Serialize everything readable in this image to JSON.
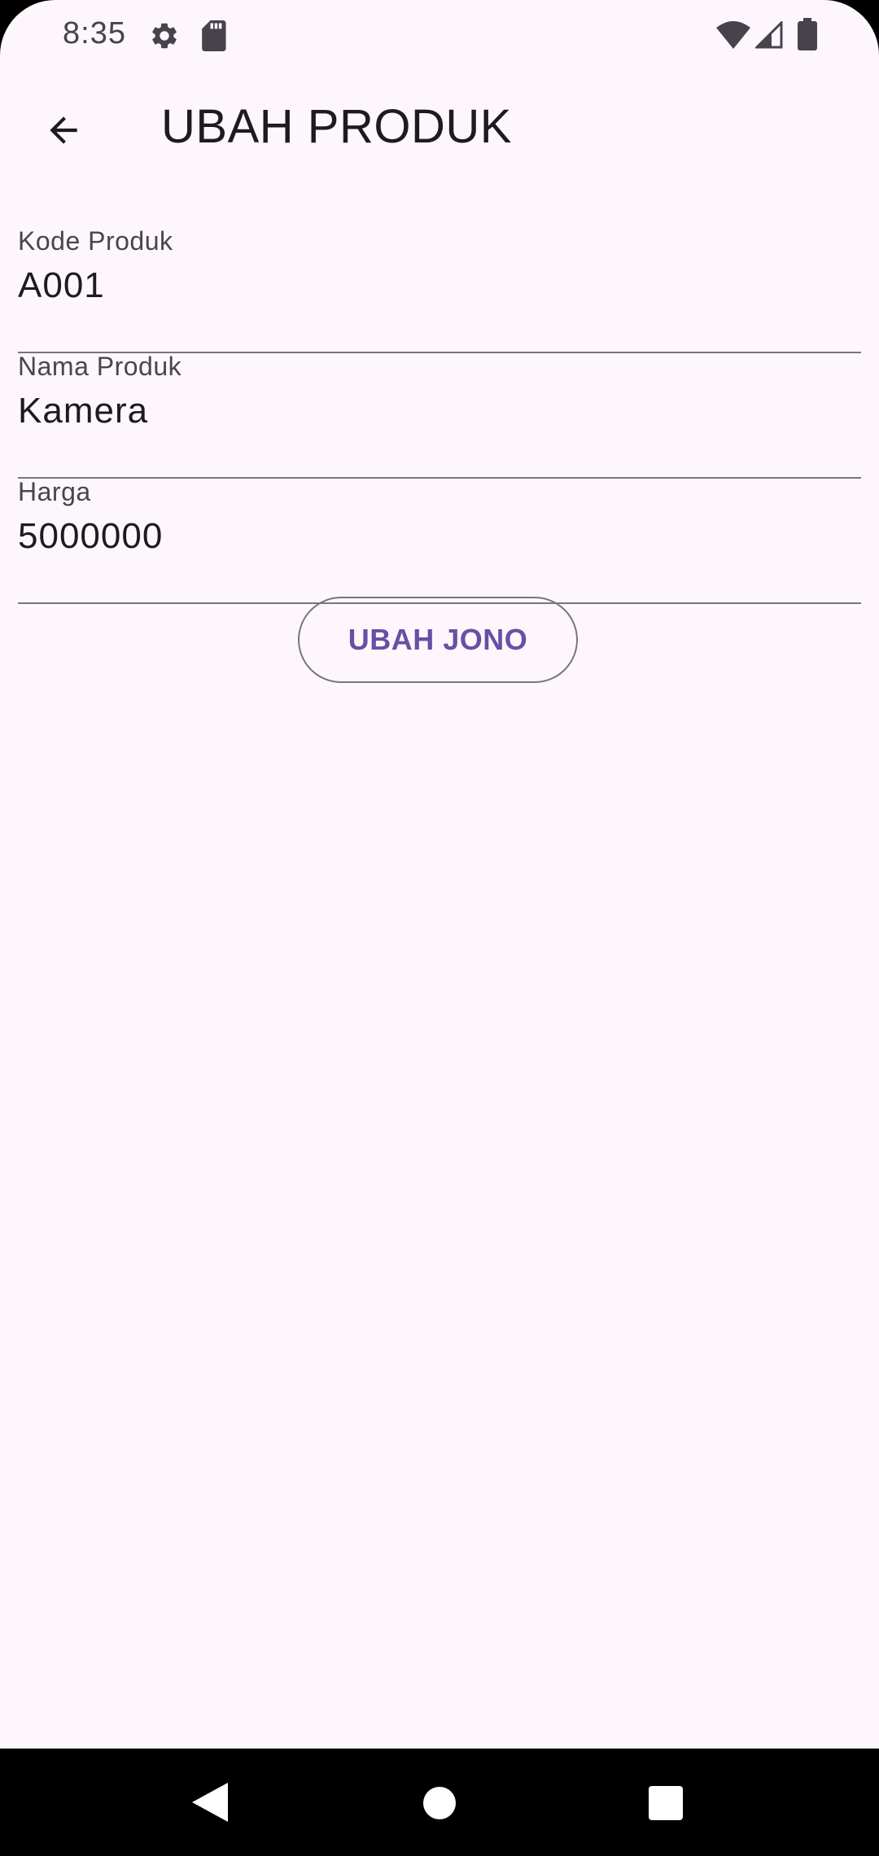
{
  "status_bar": {
    "time": "8:35",
    "icons": [
      "settings-icon",
      "sd-card-icon",
      "wifi-icon",
      "signal-icon",
      "battery-icon"
    ]
  },
  "app_bar": {
    "title": "UBAH PRODUK",
    "back_icon": "arrow-back-icon"
  },
  "form": {
    "fields": [
      {
        "label": "Kode Produk",
        "value": "A001"
      },
      {
        "label": "Nama Produk",
        "value": "Kamera"
      },
      {
        "label": "Harga",
        "value": "5000000"
      }
    ],
    "submit_label": "UBAH JONO"
  },
  "nav_bar": {
    "buttons": [
      "back-triangle-icon",
      "home-circle-icon",
      "recents-square-icon"
    ]
  },
  "colors": {
    "background": "#fdf7fd",
    "accent": "#6750a4",
    "outline": "#79747e",
    "text": "#1d1b20"
  }
}
